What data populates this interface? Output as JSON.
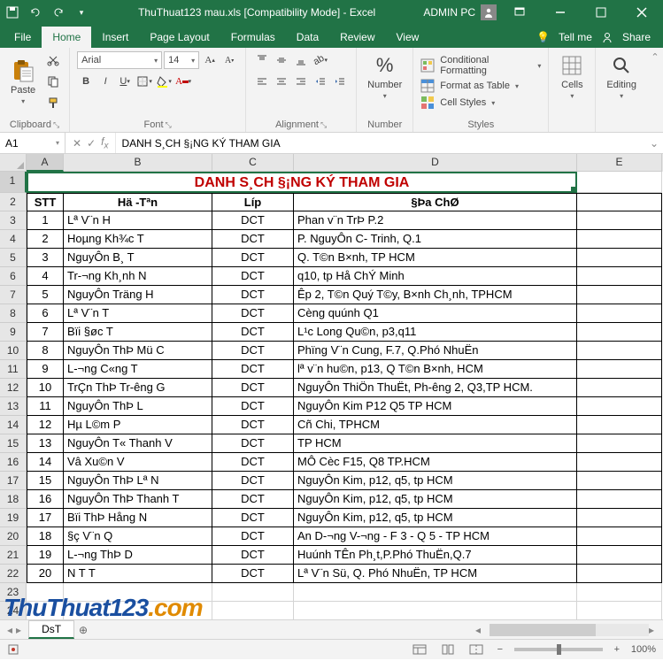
{
  "titlebar": {
    "title": "ThuThuat123 mau.xls  [Compatibility Mode]  -  Excel",
    "user": "ADMIN PC"
  },
  "tabs": {
    "file": "File",
    "home": "Home",
    "insert": "Insert",
    "pagelayout": "Page Layout",
    "formulas": "Formulas",
    "data": "Data",
    "review": "Review",
    "view": "View",
    "tellme": "Tell me",
    "share": "Share"
  },
  "ribbon": {
    "clipboard": {
      "label": "Clipboard",
      "paste": "Paste"
    },
    "font": {
      "label": "Font",
      "name": "Arial",
      "size": "14"
    },
    "alignment": {
      "label": "Alignment"
    },
    "number": {
      "label": "Number",
      "btn": "Number"
    },
    "styles": {
      "label": "Styles",
      "conditional": "Conditional Formatting",
      "table": "Format as Table",
      "cell": "Cell Styles"
    },
    "cells": {
      "label": "Cells",
      "btn": "Cells"
    },
    "editing": {
      "label": "Editing",
      "btn": "Editing"
    }
  },
  "formula_bar": {
    "name_box": "A1",
    "formula": "DANH S¸CH §¡NG KÝ THAM GIA"
  },
  "columns": [
    "A",
    "B",
    "C",
    "D",
    "E"
  ],
  "sheet": {
    "title_merged": "DANH S¸CH §¡NG KÝ THAM GIA",
    "headers": {
      "stt": "STT",
      "name": "Hä -Tªn",
      "lip": "Líp",
      "addr": "§Þa ChØ"
    },
    "rows": [
      {
        "n": "1",
        "name": "Lª V¨n H",
        "lip": "DCT",
        "addr": "Phan v¨n TrÞ P.2"
      },
      {
        "n": "2",
        "name": "Hoµng Kh¾c T",
        "lip": "DCT",
        "addr": "P. NguyÔn C- Trinh, Q.1"
      },
      {
        "n": "3",
        "name": "NguyÔn B¸ T",
        "lip": "DCT",
        "addr": "Q. T©n B×nh, TP HCM"
      },
      {
        "n": "4",
        "name": "Tr-¬ng Kh¸nh N",
        "lip": "DCT",
        "addr": "q10, tp Hå ChÝ Minh"
      },
      {
        "n": "5",
        "name": "NguyÔn Träng H",
        "lip": "DCT",
        "addr": "Êp 2, T©n Quý T©y, B×nh Ch¸nh, TPHCM"
      },
      {
        "n": "6",
        "name": "Lª V¨n T",
        "lip": "DCT",
        "addr": "Cèng quúnh Q1"
      },
      {
        "n": "7",
        "name": "Bïi §øc T",
        "lip": "DCT",
        "addr": "L¹c Long Qu©n, p3,q11"
      },
      {
        "n": "8",
        "name": "NguyÔn ThÞ Mü C",
        "lip": "DCT",
        "addr": "Phïng V¨n Cung, F.7, Q.Phó NhuËn"
      },
      {
        "n": "9",
        "name": "L-¬ng C«ng T",
        "lip": "DCT",
        "addr": "lª v¨n hu©n, p13, Q T©n B×nh, HCM"
      },
      {
        "n": "10",
        "name": "TrÇn ThÞ Tr-êng G",
        "lip": "DCT",
        "addr": "NguyÔn ThiÖn ThuËt, Ph-êng 2, Q3,TP HCM."
      },
      {
        "n": "11",
        "name": "NguyÔn ThÞ L",
        "lip": "DCT",
        "addr": "NguyÔn Kim P12 Q5 TP HCM"
      },
      {
        "n": "12",
        "name": "Hµ L©m P",
        "lip": "DCT",
        "addr": "Cñ Chi, TPHCM"
      },
      {
        "n": "13",
        "name": "NguyÔn T« Thanh V",
        "lip": "DCT",
        "addr": "TP HCM"
      },
      {
        "n": "14",
        "name": "Vâ Xu©n V",
        "lip": "DCT",
        "addr": "MÔ Cèc F15, Q8 TP.HCM"
      },
      {
        "n": "15",
        "name": "NguyÔn ThÞ Lª N",
        "lip": "DCT",
        "addr": "NguyÔn Kim, p12, q5, tp HCM"
      },
      {
        "n": "16",
        "name": "NguyÔn ThÞ Thanh T",
        "lip": "DCT",
        "addr": "NguyÔn Kim, p12, q5, tp HCM"
      },
      {
        "n": "17",
        "name": "Bïi ThÞ Hång N",
        "lip": "DCT",
        "addr": "NguyÔn Kim, p12, q5, tp HCM"
      },
      {
        "n": "18",
        "name": "§ç V¨n Q",
        "lip": "DCT",
        "addr": "An D-¬ng V-¬ng - F 3 - Q 5 - TP HCM"
      },
      {
        "n": "19",
        "name": " L-¬ng ThÞ D",
        "lip": "DCT",
        "addr": "Huúnh TÊn Ph¸t,P.Phó ThuËn,Q.7"
      },
      {
        "n": "20",
        "name": "N       T    T",
        "lip": "DCT",
        "addr": "Lª V¨n Sü, Q. Phó NhuËn, TP HCM"
      }
    ]
  },
  "sheet_tabs": {
    "active": "DsT"
  },
  "statusbar": {
    "zoom": "100%"
  },
  "watermark": {
    "a": "ThuThuat123",
    "b": ".com"
  }
}
